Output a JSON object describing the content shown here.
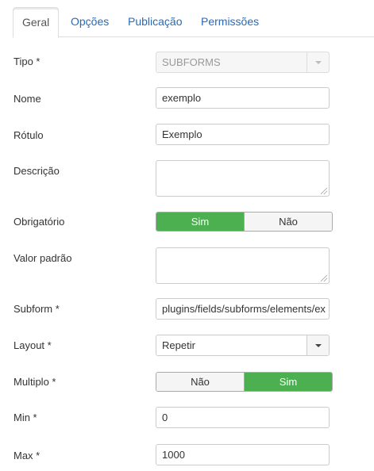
{
  "tabs": [
    {
      "label": "Geral"
    },
    {
      "label": "Opções"
    },
    {
      "label": "Publicação"
    },
    {
      "label": "Permissões"
    }
  ],
  "fields": {
    "tipo": {
      "label": "Tipo *",
      "value": "SUBFORMS"
    },
    "nome": {
      "label": "Nome",
      "value": "exemplo"
    },
    "rotulo": {
      "label": "Rótulo",
      "value": "Exemplo"
    },
    "descricao": {
      "label": "Descrição",
      "value": ""
    },
    "obrigatorio": {
      "label": "Obrigatório",
      "option_first": "Sim",
      "option_second": "Não",
      "selected": "Sim"
    },
    "valor_padrao": {
      "label": "Valor padrão",
      "value": ""
    },
    "subform": {
      "label": "Subform *",
      "value": "plugins/fields/subforms/elements/ex"
    },
    "layout": {
      "label": "Layout *",
      "value": "Repetir"
    },
    "multiplo": {
      "label": "Multiplo *",
      "option_first": "Não",
      "option_second": "Sim",
      "selected": "Sim"
    },
    "min": {
      "label": "Min *",
      "value": "0"
    },
    "max": {
      "label": "Max *",
      "value": "1000"
    }
  },
  "colors": {
    "accent": "#4caf50",
    "link": "#2a69b8"
  }
}
